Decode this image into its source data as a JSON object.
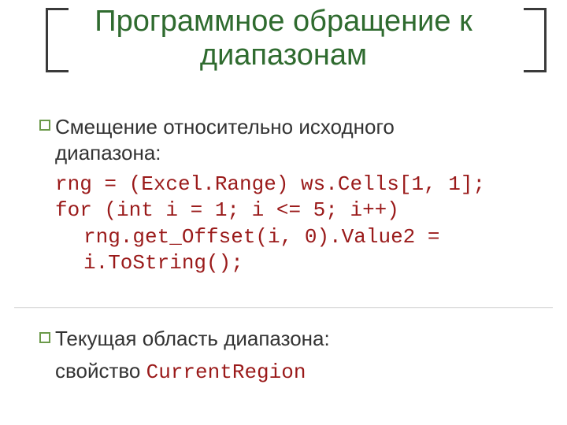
{
  "title": {
    "line1": "Программное обращение к",
    "line2": "диапазонам"
  },
  "section1": {
    "intro_line1": "Смещение относительно исходного",
    "intro_line2": "диапазона:",
    "code": {
      "l1": "rng = (Excel.Range) ws.Cells[1, 1];",
      "l2": "for (int i = 1; i <= 5; i++)",
      "l3": "rng.get_Offset(i, 0).Value2 =",
      "l4": "i.ToString();"
    }
  },
  "section2": {
    "intro": "Текущая область диапазона:",
    "property_label": "свойство ",
    "property_name": "CurrentRegion"
  }
}
